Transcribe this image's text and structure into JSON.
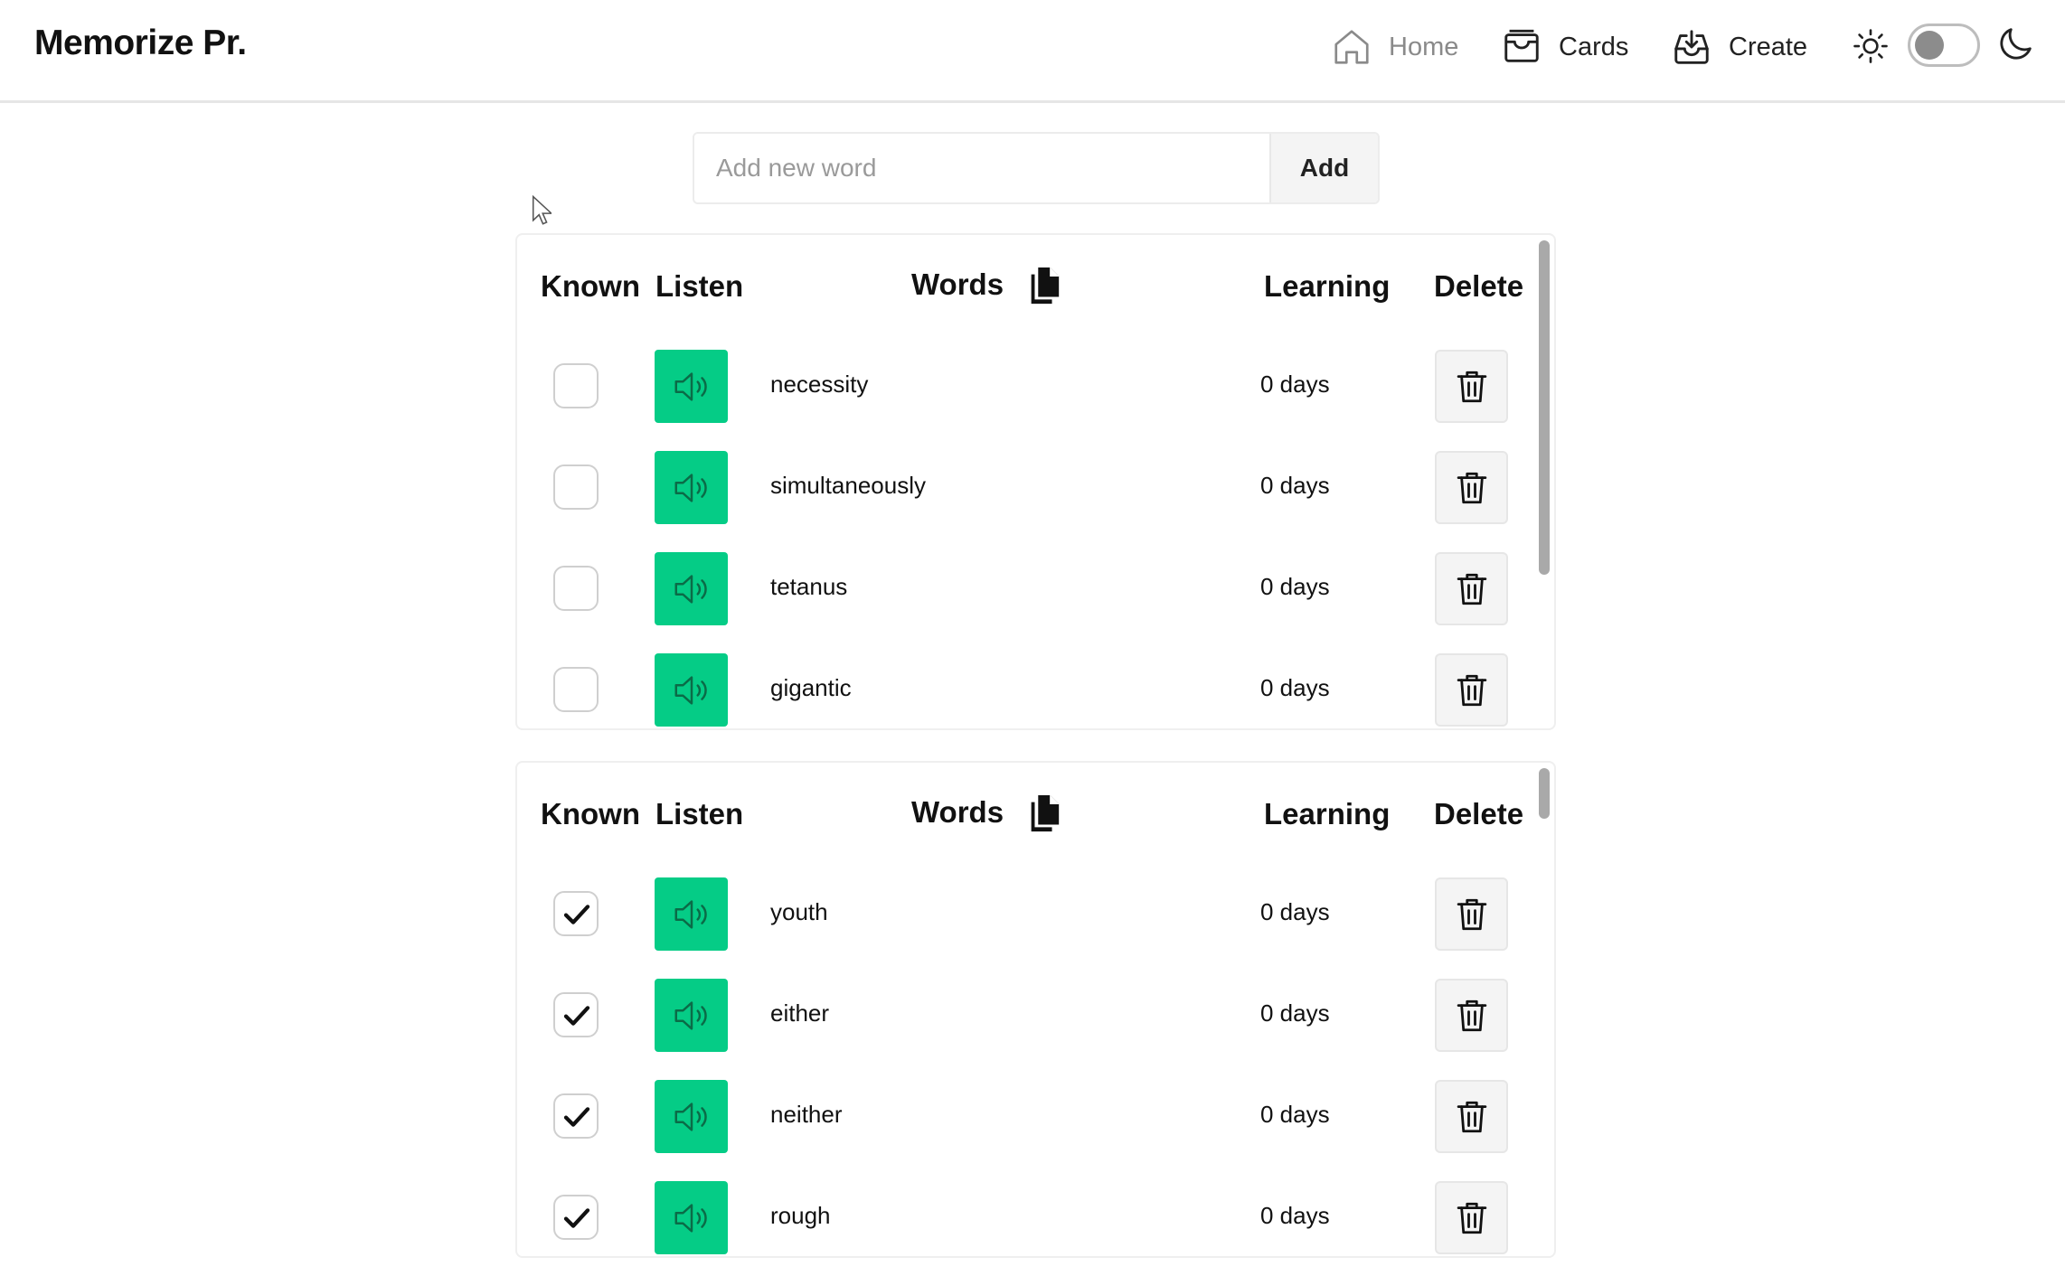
{
  "header": {
    "brand": "Memorize Pr.",
    "nav": [
      {
        "label": "Home",
        "icon": "home-icon",
        "active": false
      },
      {
        "label": "Cards",
        "icon": "cards-icon"
      },
      {
        "label": "Create",
        "icon": "create-icon"
      }
    ],
    "theme": {
      "light_icon": "sun-icon",
      "dark_icon": "moon-icon",
      "dark_mode": false
    }
  },
  "add_form": {
    "placeholder": "Add new word",
    "button_label": "Add"
  },
  "tables": [
    {
      "columns": {
        "known": "Known",
        "listen": "Listen",
        "words": "Words",
        "learning": "Learning",
        "delete": "Delete"
      },
      "rows": [
        {
          "word": "necessity",
          "known": false,
          "learning": "0 days"
        },
        {
          "word": "simultaneously",
          "known": false,
          "learning": "0 days"
        },
        {
          "word": "tetanus",
          "known": false,
          "learning": "0 days"
        },
        {
          "word": "gigantic",
          "known": false,
          "learning": "0 days"
        }
      ]
    },
    {
      "columns": {
        "known": "Known",
        "listen": "Listen",
        "words": "Words",
        "learning": "Learning",
        "delete": "Delete"
      },
      "rows": [
        {
          "word": "youth",
          "known": true,
          "learning": "0 days"
        },
        {
          "word": "either",
          "known": true,
          "learning": "0 days"
        },
        {
          "word": "neither",
          "known": true,
          "learning": "0 days"
        },
        {
          "word": "rough",
          "known": true,
          "learning": "0 days"
        }
      ]
    }
  ],
  "colors": {
    "listen_button": "#05cc86",
    "muted_nav": "#8a8a8a"
  }
}
